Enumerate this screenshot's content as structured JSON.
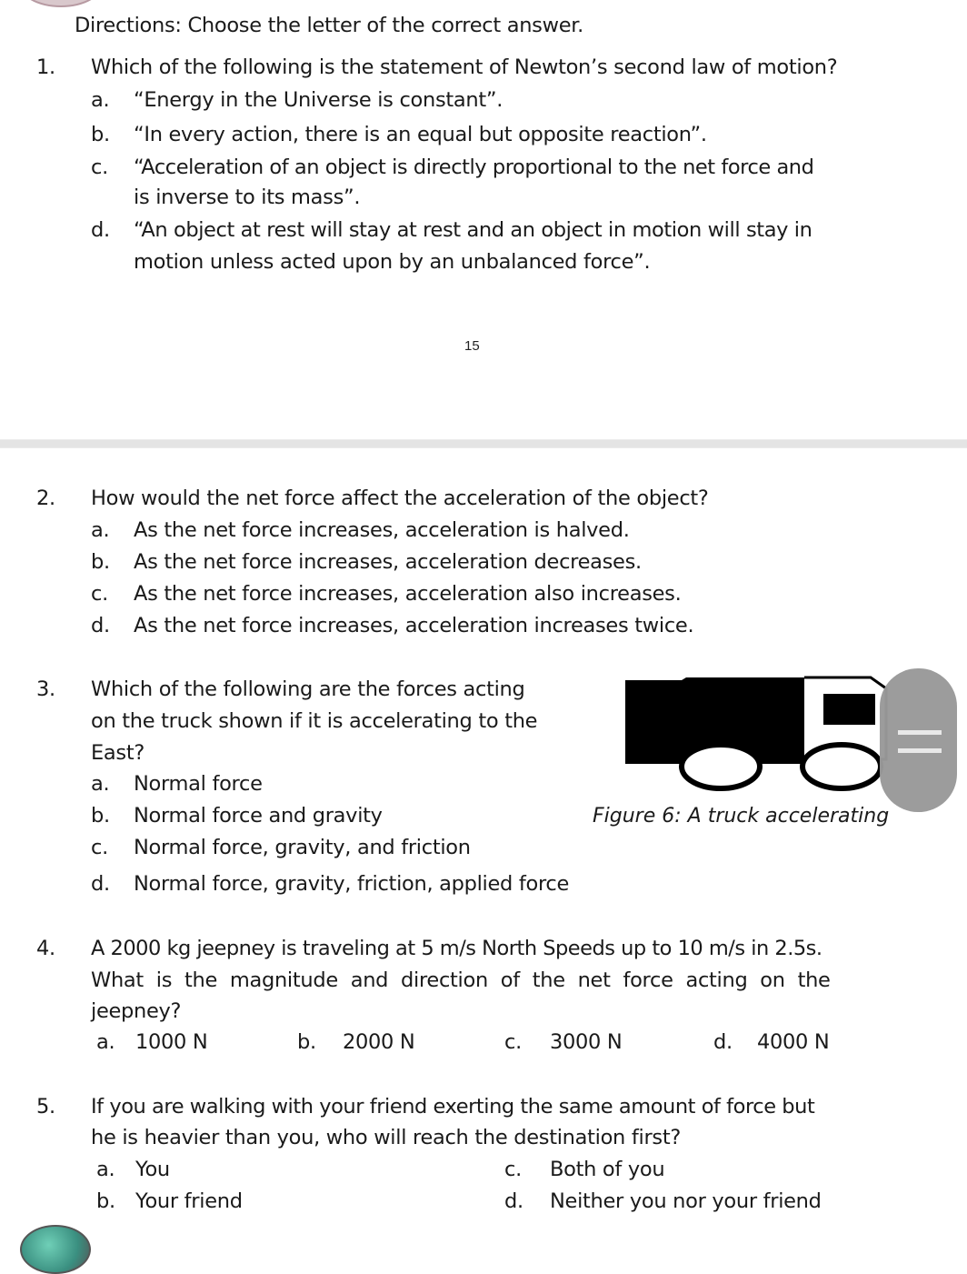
{
  "directions": "Directions: Choose the letter of the correct answer.",
  "page_number": "15",
  "questions": [
    {
      "number": "1.",
      "text": "Which of the following is the statement of Newton’s second law of motion?",
      "options": [
        {
          "letter": "a.",
          "text": "“Energy in the Universe is constant”."
        },
        {
          "letter": "b.",
          "text": "“In every action, there is an equal but opposite reaction”."
        },
        {
          "letter": "c.",
          "text_line1": "“Acceleration of an object is directly proportional to the net force and",
          "text_line2": "is inverse to its mass”."
        },
        {
          "letter": "d.",
          "text_line1": "“An object at rest will stay at rest and an object in motion will stay in",
          "text_line2": "motion unless acted upon by an unbalanced force”."
        }
      ]
    },
    {
      "number": "2.",
      "text": "How would the net force affect the acceleration of the object?",
      "options": [
        {
          "letter": "a.",
          "text": "As the net force increases, acceleration is halved."
        },
        {
          "letter": "b.",
          "text": "As the net force increases, acceleration decreases."
        },
        {
          "letter": "c.",
          "text": "As the net force increases, acceleration also increases."
        },
        {
          "letter": "d.",
          "text": "As the net force increases, acceleration increases twice."
        }
      ]
    },
    {
      "number": "3.",
      "text_line1": "Which of the following are the forces acting",
      "text_line2": "on the truck shown if it is accelerating to the",
      "text_line3": "East?",
      "figure_caption": "Figure 6: A truck accelerating",
      "options": [
        {
          "letter": "a.",
          "text": "Normal force"
        },
        {
          "letter": "b.",
          "text": "Normal force and gravity"
        },
        {
          "letter": "c.",
          "text": "Normal force, gravity, and friction"
        },
        {
          "letter": "d.",
          "text": "Normal force, gravity, friction, applied force"
        }
      ]
    },
    {
      "number": "4.",
      "text_line1": "A 2000 kg jeepney is traveling at 5 m/s North Speeds up to 10 m/s in 2.5s.",
      "text_line2": "What is the magnitude and direction of the net force acting on the",
      "text_line3": "jeepney?",
      "options": [
        {
          "letter": "a.",
          "text": "1000 N"
        },
        {
          "letter": "b.",
          "text": "2000 N"
        },
        {
          "letter": "c.",
          "text": "3000 N"
        },
        {
          "letter": "d.",
          "text": "4000 N"
        }
      ]
    },
    {
      "number": "5.",
      "text_line1": "If you are walking with your friend exerting the same amount of force but",
      "text_line2": "he is heavier than you, who will reach the destination first?",
      "options": [
        {
          "letter": "a.",
          "text": "You"
        },
        {
          "letter": "b.",
          "text": "Your friend"
        },
        {
          "letter": "c.",
          "text": "Both of you"
        },
        {
          "letter": "d.",
          "text": "Neither you nor your friend"
        }
      ]
    }
  ],
  "colors": {
    "text": "#1a1a1a",
    "page_gap": "#e4e4e4",
    "scroll_handle": "#999999",
    "truck": "#000000"
  }
}
